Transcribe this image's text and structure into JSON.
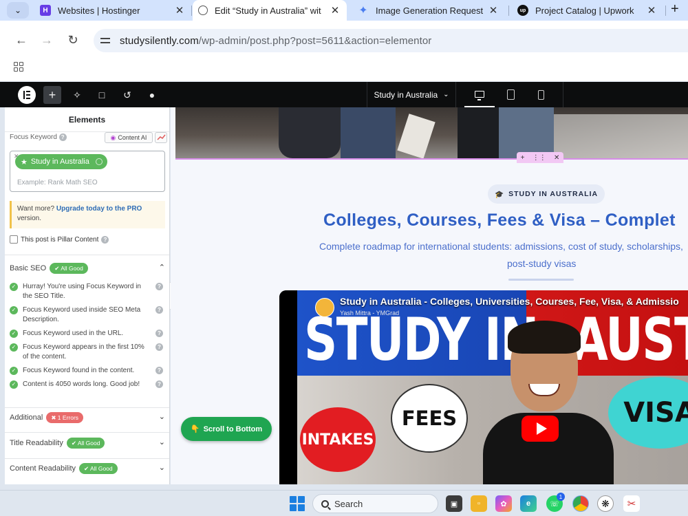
{
  "browser": {
    "tabs": [
      {
        "title": "Websites | Hostinger",
        "active": false
      },
      {
        "title": "Edit “Study in Australia” wit",
        "active": true
      },
      {
        "title": "Image Generation Request",
        "active": false
      },
      {
        "title": "Project Catalog | Upwork",
        "active": false
      }
    ],
    "url_host": "studysilently.com",
    "url_path": "/wp-admin/post.php?post=5611&action=elementor"
  },
  "editor": {
    "page_name": "Study in Australia",
    "panel_title": "Elements"
  },
  "seo": {
    "focus_keyword_label": "Focus Keyword",
    "content_ai_label": "Content AI",
    "keyword_chip": "Study in Australia",
    "keyword_placeholder": "Example: Rank Math SEO",
    "promo_prefix": "Want more?",
    "promo_link": "Upgrade today to the PRO",
    "promo_suffix": "version.",
    "pillar_label": "This post is Pillar Content",
    "basic_seo": {
      "title": "Basic SEO",
      "badge": "✔ All Good",
      "items": [
        "Hurray! You're using Focus Keyword in the SEO Title.",
        "Focus Keyword used inside SEO Meta Description.",
        "Focus Keyword used in the URL.",
        "Focus Keyword appears in the first 10% of the content.",
        "Focus Keyword found in the content.",
        "Content is 4050 words long. Good job!"
      ]
    },
    "additional": {
      "title": "Additional",
      "badge": "✖ 1 Errors"
    },
    "title_readability": {
      "title": "Title Readability",
      "badge": "✔ All Good"
    },
    "content_readability": {
      "title": "Content Readability",
      "badge": "✔ All Good"
    }
  },
  "canvas": {
    "tag": "STUDY IN AUSTRALIA",
    "headline": "Colleges, Courses, Fees & Visa – Complet",
    "subline_1": "Complete roadmap for international students: admissions, cost of study, scholarships,",
    "subline_2": "post-study visas",
    "video": {
      "title": "Study in Australia - Colleges, Universities, Courses, Fee, Visa, & Admissio",
      "channel": "Yash Mittra - YMGrad",
      "big_left": "STUDY IN",
      "big_right": "AUSTR",
      "bubble_1": "INTAKES",
      "bubble_2": "FEES",
      "bubble_3": "VISA"
    },
    "scroll_button": "Scroll to Bottom"
  },
  "taskbar": {
    "search_label": "Search",
    "whatsapp_badge": "1"
  },
  "colors": {
    "accent_green": "#5cb85c",
    "error_red": "#e96b6b",
    "headline_blue": "#2f5fc4",
    "elementor_bar": "#0c0d0e"
  }
}
